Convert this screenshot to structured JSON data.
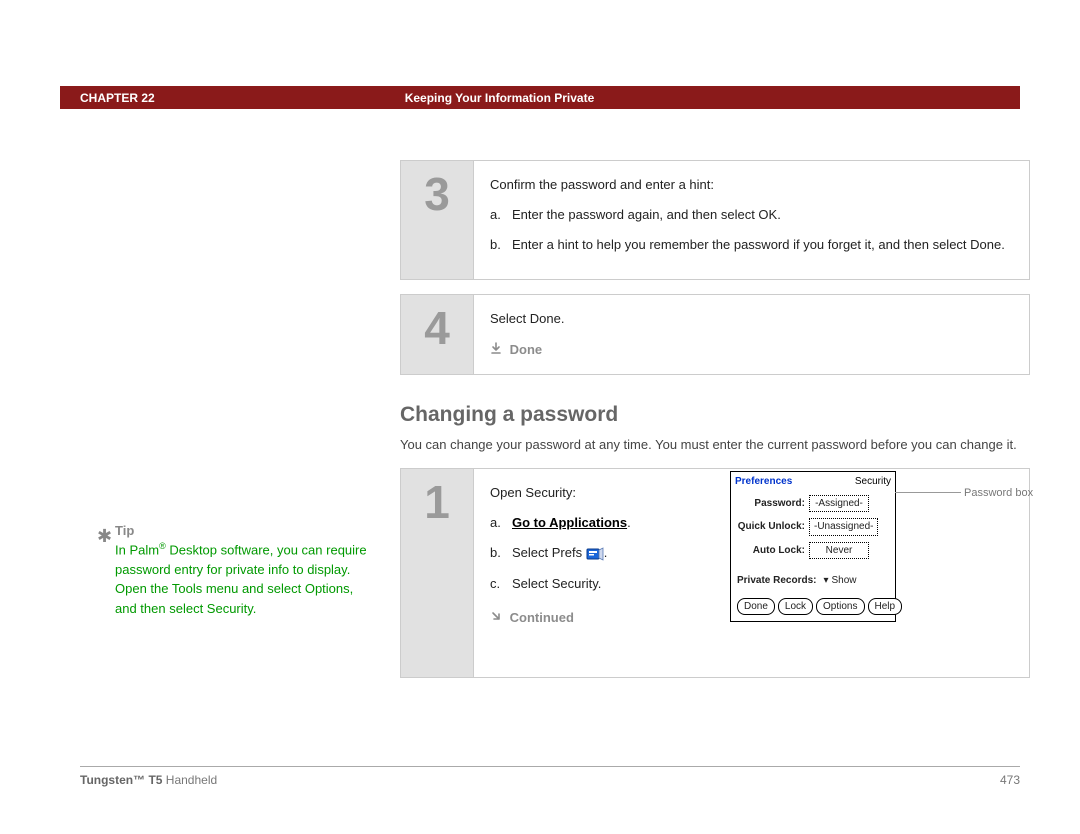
{
  "header": {
    "chapter": "CHAPTER 22",
    "title": "Keeping Your Information Private"
  },
  "step3": {
    "num": "3",
    "lead": "Confirm the password and enter a hint:",
    "a_letter": "a.",
    "a_text": "Enter the password again, and then select OK.",
    "b_letter": "b.",
    "b_text": "Enter a hint to help you remember the password if you forget it, and then select Done."
  },
  "step4": {
    "num": "4",
    "text": "Select Done.",
    "done": "Done"
  },
  "section": {
    "title": "Changing a password",
    "desc": "You can change your password at any time. You must enter the current password before you can change it."
  },
  "tip": {
    "label": "Tip",
    "text_pre": "In Palm",
    "reg": "®",
    "text_post": " Desktop software, you can require password entry for private info to display. Open the Tools menu and select Options, and then select Security."
  },
  "step1": {
    "num": "1",
    "lead": "Open Security:",
    "a_letter": "a.",
    "a_link": "Go to Applications",
    "a_suffix": ".",
    "b_letter": "b.",
    "b_text_pre": "Select Prefs ",
    "b_text_post": ".",
    "c_letter": "c.",
    "c_text": "Select Security.",
    "continued": "Continued"
  },
  "palm": {
    "prefs": "Preferences",
    "security": "Security",
    "password_lab": "Password:",
    "password_val": "-Assigned-",
    "quick_lab": "Quick Unlock:",
    "quick_val": "-Unassigned-",
    "auto_lab": "Auto Lock:",
    "auto_val": "Never",
    "private_lab": "Private Records:",
    "private_val": "Show",
    "btn_done": "Done",
    "btn_lock": "Lock",
    "btn_options": "Options",
    "btn_help": "Help",
    "callout": "Password box"
  },
  "footer": {
    "product_bold": "Tungsten™ T5",
    "product_rest": " Handheld",
    "page": "473"
  }
}
